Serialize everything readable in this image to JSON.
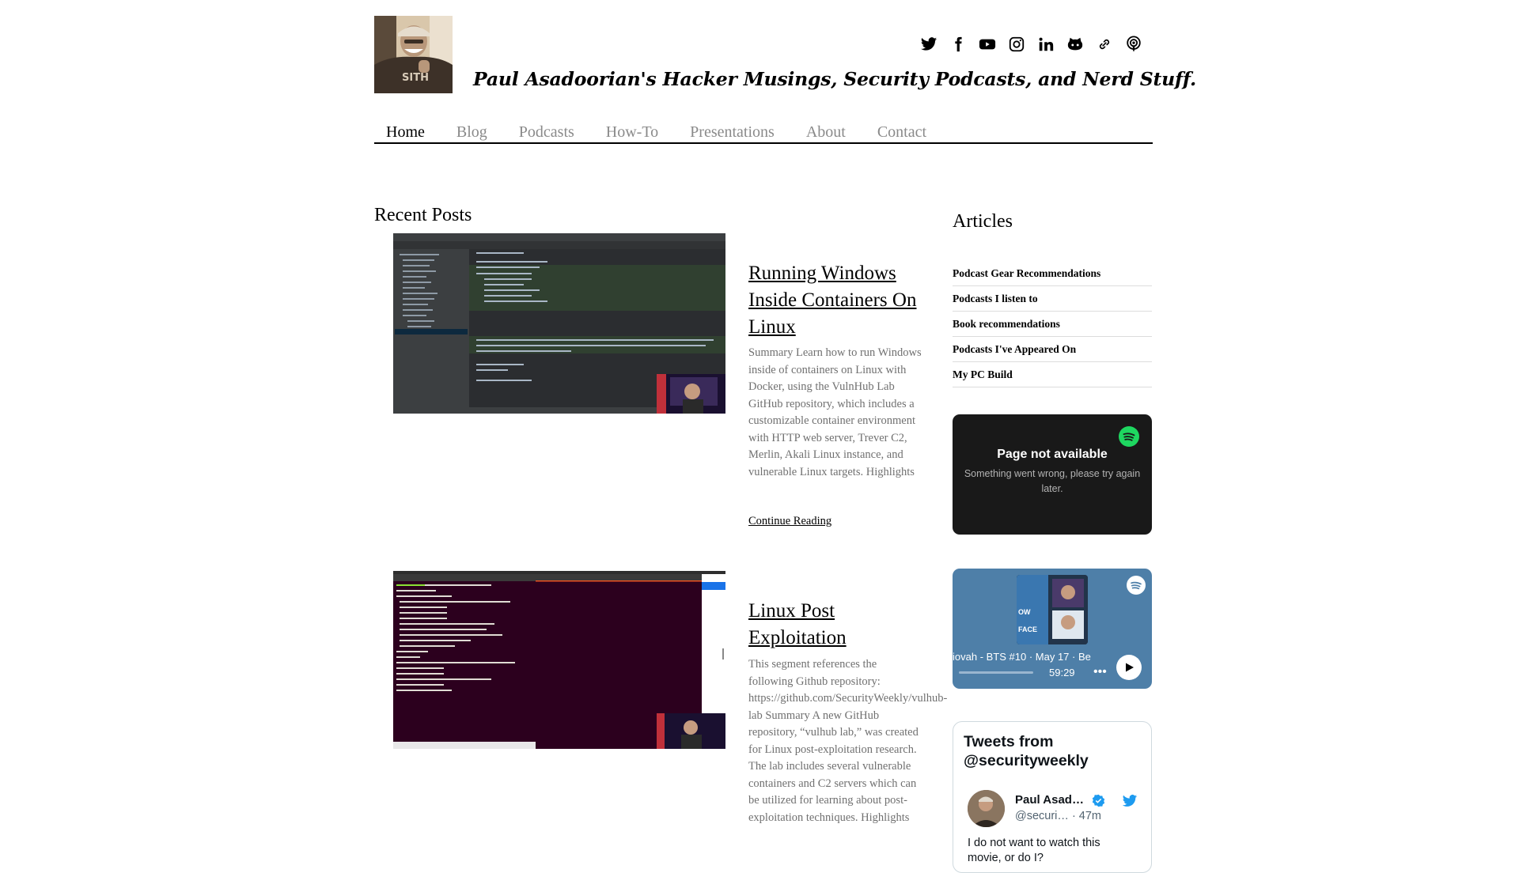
{
  "header": {
    "tagline": "Paul Asadoorian's Hacker Musings, Security Podcasts, and Nerd Stuff.",
    "avatar_alt": "Paul Asadoorian",
    "social_icons": [
      "twitter-icon",
      "facebook-icon",
      "youtube-icon",
      "instagram-icon",
      "linkedin-icon",
      "github-icon",
      "link-icon",
      "podcast-icon"
    ]
  },
  "nav": {
    "items": [
      {
        "label": "Home",
        "active": true
      },
      {
        "label": "Blog",
        "active": false
      },
      {
        "label": "Podcasts",
        "active": false
      },
      {
        "label": "How-To",
        "active": false
      },
      {
        "label": "Presentations",
        "active": false
      },
      {
        "label": "About",
        "active": false
      },
      {
        "label": "Contact",
        "active": false
      }
    ]
  },
  "recent_posts": {
    "title": "Recent Posts",
    "posts": [
      {
        "title": "Running Windows Inside Containers On Linux",
        "excerpt": "Summary Learn how to run Windows inside of containers on Linux with Docker, using the VulnHub Lab GitHub repository, which includes a customizable container environment with HTTP web server, Trever C2, Merlin, Akali Linux instance, and vulnerable Linux targets. Highlights",
        "continue_label": "Continue Reading"
      },
      {
        "title": "Linux Post Exploitation",
        "excerpt": "This segment references the following Github repository: https://github.com/SecurityWeekly/vulhub-lab Summary A new GitHub repository, “vulhub lab,” was created for Linux post-exploitation research. The lab includes several vulnerable containers and C2 servers which can be utilized for learning about post-exploitation techniques. Highlights"
      }
    ]
  },
  "sidebar": {
    "articles_title": "Articles",
    "articles": [
      "Podcast Gear Recommendations",
      "Podcasts I listen to",
      "Book recommendations",
      "Podcasts I've Appeared On",
      "My PC Build"
    ],
    "spotify_error": {
      "title": "Page not available",
      "message": "Something went wrong, please try again later."
    },
    "spotify_player": {
      "ticker": "iovah - BTS #10 · May 17 · Be",
      "duration": "59:29",
      "more": "•••",
      "art_text_1": "OW",
      "art_text_2": "FACE"
    },
    "tweets": {
      "title": "Tweets from @securityweekly",
      "author_name": "Paul Asad…",
      "author_handle": "@securi…",
      "time": "· 47m",
      "text": "I do not want to watch this movie, or do I?"
    }
  },
  "colors": {
    "spotify_green": "#1ed760",
    "spotify_dark": "#191919",
    "spotify_blue": "#4e7fa8",
    "twitter_blue": "#1d9bf0",
    "nav_inactive": "#8a8a8a",
    "excerpt_gray": "#707070"
  }
}
